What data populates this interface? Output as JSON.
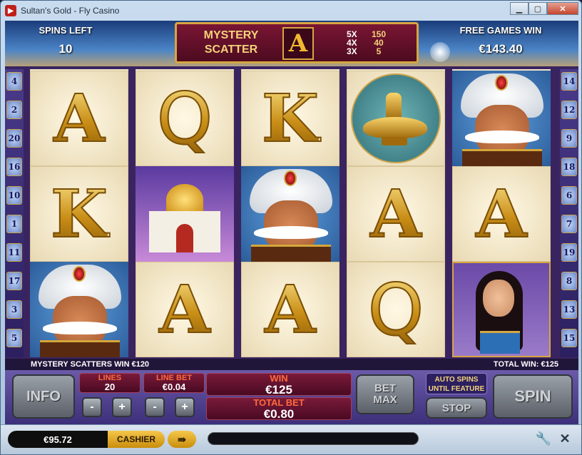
{
  "window": {
    "title": "Sultan's Gold - Fly Casino",
    "app_icon": "casino-logo-icon",
    "min_icon": "minimize-icon",
    "max_icon": "maximize-icon",
    "close_icon": "close-icon"
  },
  "header": {
    "spins_left_label": "SPINS LEFT",
    "spins_left_value": "10",
    "mystery_label_line1": "MYSTERY",
    "mystery_label_line2": "SCATTER",
    "mystery_symbol": "A",
    "paytable": [
      {
        "mult": "5X",
        "pay": "150"
      },
      {
        "mult": "4X",
        "pay": "40"
      },
      {
        "mult": "3X",
        "pay": "5"
      }
    ],
    "free_games_win_label": "FREE GAMES WIN",
    "free_games_win_value": "€143.40"
  },
  "paylines": {
    "left": [
      "4",
      "2",
      "20",
      "16",
      "10",
      "1",
      "11",
      "17",
      "3",
      "5"
    ],
    "right": [
      "14",
      "12",
      "9",
      "18",
      "6",
      "7",
      "19",
      "8",
      "13",
      "15"
    ]
  },
  "reels": [
    [
      "A",
      "K",
      "sultan"
    ],
    [
      "Q",
      "palace",
      "A"
    ],
    [
      "K",
      "sultan",
      "A"
    ],
    [
      "lamp",
      "A",
      "Q"
    ],
    [
      "sultan",
      "A",
      "dancer"
    ]
  ],
  "status": {
    "left": "MYSTERY SCATTERS WIN €120",
    "right": "TOTAL WIN: €125"
  },
  "controls": {
    "info_label": "INFO",
    "lines_label": "LINES",
    "lines_value": "20",
    "line_bet_label": "LINE BET",
    "line_bet_value": "€0.04",
    "minus": "-",
    "plus": "+",
    "win_label": "WIN",
    "win_value": "€125",
    "total_bet_label": "TOTAL BET",
    "total_bet_value": "€0.80",
    "bet_max_line1": "BET",
    "bet_max_line2": "MAX",
    "auto_spins_line1": "AUTO SPINS",
    "auto_spins_line2": "UNTIL FEATURE",
    "stop_label": "STOP",
    "spin_label": "SPIN"
  },
  "taskbar": {
    "balance": "€95.72",
    "cashier_label": "CASHIER",
    "coin_icon": "coins-arrow-icon",
    "wrench_icon": "wrench-icon",
    "close_icon": "close-icon"
  }
}
